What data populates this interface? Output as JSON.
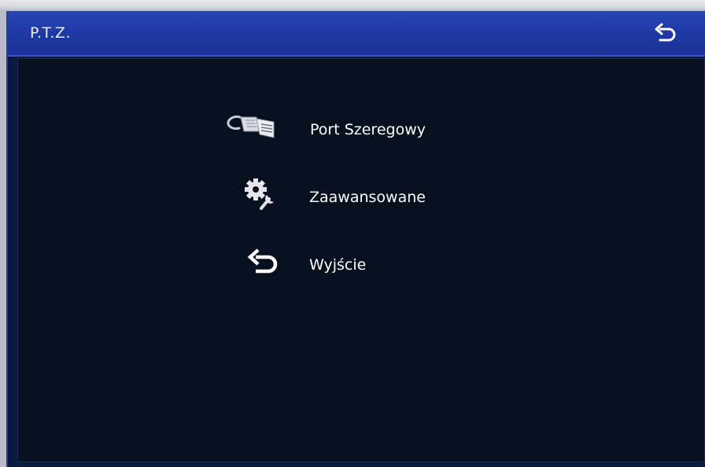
{
  "header": {
    "title": "P.T.Z.",
    "back_icon": "return-icon"
  },
  "menu": {
    "items": [
      {
        "label": "Port Szeregowy",
        "icon": "serial-cable-icon"
      },
      {
        "label": "Zaawansowane",
        "icon": "gear-wrench-icon"
      },
      {
        "label": "Wyjście",
        "icon": "return-icon"
      }
    ]
  },
  "colors": {
    "header_bg": "#1f3aa6",
    "content_bg": "#06101f",
    "text": "#ffffff"
  }
}
